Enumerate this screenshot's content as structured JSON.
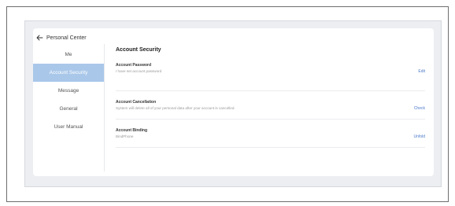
{
  "header": {
    "title": "Personal Center"
  },
  "sidebar": {
    "items": [
      {
        "label": "Me"
      },
      {
        "label": "Account Security"
      },
      {
        "label": "Message"
      },
      {
        "label": "General"
      },
      {
        "label": "User Manual"
      }
    ],
    "active_index": 1
  },
  "main": {
    "title": "Account Security",
    "rows": [
      {
        "label": "Account Password",
        "description": "I have set account password",
        "action": "Edit"
      },
      {
        "label": "Account Cancellation",
        "description": "System will delete all of your personal data after your account is cancelled.",
        "action": "Check"
      },
      {
        "label": "Account Binding",
        "description": "BindPhone",
        "action": "Unfold"
      }
    ]
  },
  "colors": {
    "accent": "#4a79c9",
    "sidebar_active": "#a9c7e9",
    "background": "#eceef1"
  },
  "icons": {
    "back": "arrow-left-icon"
  }
}
